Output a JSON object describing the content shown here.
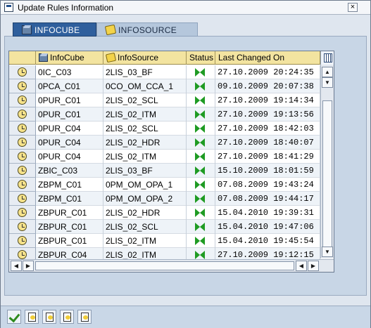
{
  "window": {
    "title": "Update Rules Information",
    "close_glyph": "×"
  },
  "tabs": [
    {
      "label": "INFOCUBE",
      "icon": "cube-icon",
      "active": true
    },
    {
      "label": "INFOSOURCE",
      "icon": "infosource-icon",
      "active": false
    }
  ],
  "grid": {
    "columns": [
      {
        "label": "InfoCube",
        "icon": "cube-icon"
      },
      {
        "label": "InfoSource",
        "icon": "infosource-icon"
      },
      {
        "label": "Status"
      },
      {
        "label": "Last Changed On"
      }
    ],
    "rows": [
      {
        "cube": "0IC_C03",
        "source": "2LIS_03_BF",
        "status": "green",
        "changed": "27.10.2009 20:24:35"
      },
      {
        "cube": "0PCA_C01",
        "source": "0CO_OM_CCA_1",
        "status": "green",
        "changed": "09.10.2009 20:07:38"
      },
      {
        "cube": "0PUR_C01",
        "source": "2LIS_02_SCL",
        "status": "green",
        "changed": "27.10.2009 19:14:34"
      },
      {
        "cube": "0PUR_C01",
        "source": "2LIS_02_ITM",
        "status": "green",
        "changed": "27.10.2009 19:13:56"
      },
      {
        "cube": "0PUR_C04",
        "source": "2LIS_02_SCL",
        "status": "green",
        "changed": "27.10.2009 18:42:03"
      },
      {
        "cube": "0PUR_C04",
        "source": "2LIS_02_HDR",
        "status": "green",
        "changed": "27.10.2009 18:40:07"
      },
      {
        "cube": "0PUR_C04",
        "source": "2LIS_02_ITM",
        "status": "green",
        "changed": "27.10.2009 18:41:29"
      },
      {
        "cube": "ZBIC_C03",
        "source": "2LIS_03_BF",
        "status": "green",
        "changed": "15.10.2009 18:01:59"
      },
      {
        "cube": "ZBPM_C01",
        "source": "0PM_OM_OPA_1",
        "status": "green",
        "changed": "07.08.2009 19:43:24"
      },
      {
        "cube": "ZBPM_C01",
        "source": "0PM_OM_OPA_2",
        "status": "green",
        "changed": "07.08.2009 19:44:17"
      },
      {
        "cube": "ZBPUR_C01",
        "source": "2LIS_02_HDR",
        "status": "green",
        "changed": "15.04.2010 19:39:31"
      },
      {
        "cube": "ZBPUR_C01",
        "source": "2LIS_02_SCL",
        "status": "green",
        "changed": "15.04.2010 19:47:06"
      },
      {
        "cube": "ZBPUR_C01",
        "source": "2LIS_02_ITM",
        "status": "green",
        "changed": "15.04.2010 19:45:54"
      },
      {
        "cube": "ZBPUR_C04",
        "source": "2LIS_02_ITM",
        "status": "green",
        "changed": "27.10.2009 19:12:15"
      }
    ]
  },
  "scroll": {
    "up": "▲",
    "down": "▼",
    "left": "◀",
    "right": "▶"
  },
  "colors": {
    "tab_active": "#2f5f9d",
    "header_bg": "#f3e4a0",
    "status_green": "#1f9b23"
  },
  "toolbar": [
    {
      "name": "continue-button",
      "icon": "checkmark-icon"
    },
    {
      "name": "change-button",
      "icon": "change-doc-icon"
    },
    {
      "name": "display-button",
      "icon": "display-doc-icon"
    },
    {
      "name": "create-button",
      "icon": "create-doc-icon"
    },
    {
      "name": "copy-button",
      "icon": "copy-doc-icon"
    }
  ]
}
